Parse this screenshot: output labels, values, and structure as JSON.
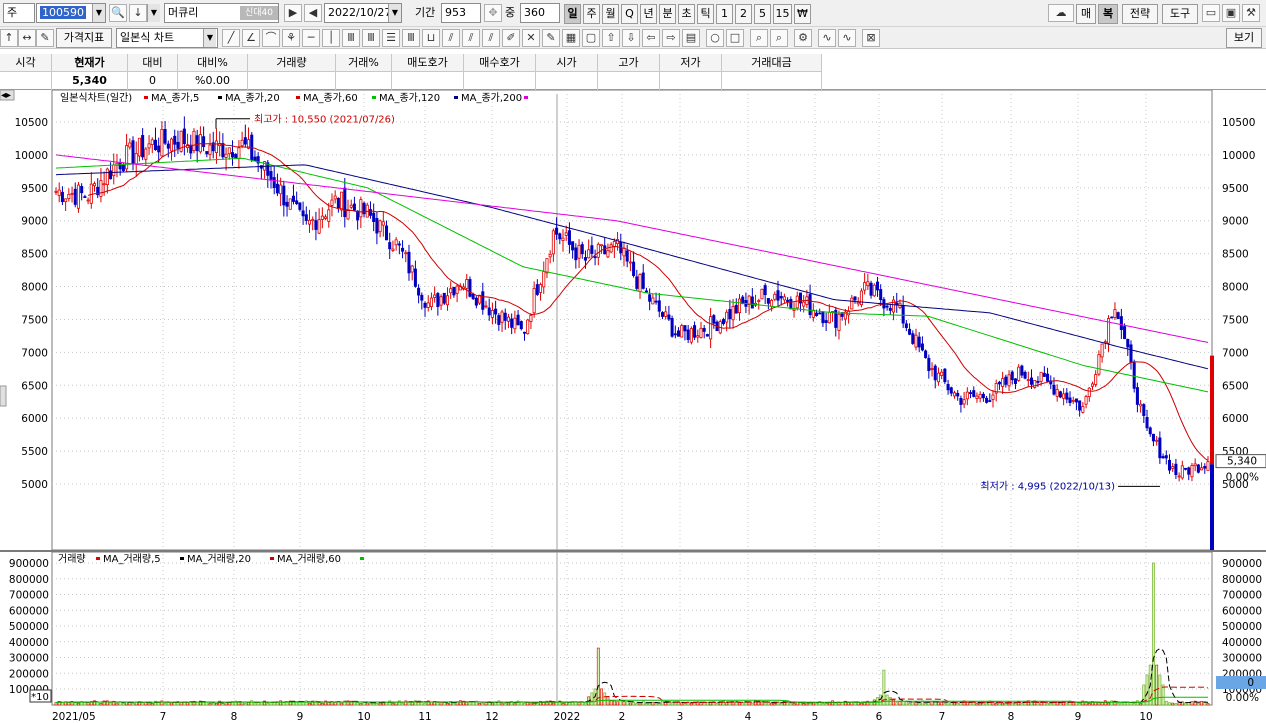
{
  "toolbar": {
    "market": "주",
    "code": "100590",
    "name": "머큐리",
    "name_tags": [
      "신",
      "대",
      "40"
    ],
    "date": "2022/10/27",
    "period_label": "기간",
    "period_value": "953",
    "count_label": "중",
    "count_value": "360",
    "timeframes": [
      "일",
      "주",
      "월",
      "Q",
      "년",
      "분",
      "초",
      "틱",
      "1",
      "2",
      "5",
      "15",
      "₩"
    ],
    "active_timeframe": "일",
    "right_buttons": [
      "매",
      "복",
      "전략",
      "도구"
    ]
  },
  "toolbar2": {
    "indicator_btn": "가격지표",
    "chart_type": "일본식 차트",
    "view_btn": "보기"
  },
  "quote": {
    "headers": [
      "시각",
      "현재가",
      "대비",
      "대비%",
      "거래량",
      "거래%",
      "매도호가",
      "매수호가",
      "시가",
      "고가",
      "저가",
      "거래대금"
    ],
    "values": [
      "",
      "5,340",
      "0",
      "%0.00",
      "",
      "",
      "",
      "",
      "",
      "",
      "",
      ""
    ]
  },
  "price_panel": {
    "legend_title": "일본식차트(일간)",
    "ma_legend": [
      {
        "label": "MA_종가,5",
        "color": "#e00000"
      },
      {
        "label": "MA_종가,20",
        "color": "#000000"
      },
      {
        "label": "MA_종가,60",
        "color": "#d00000"
      },
      {
        "label": "MA_종가,120",
        "color": "#00c000"
      },
      {
        "label": "MA_종가,200",
        "color": "#000080"
      },
      {
        "label": "",
        "color": "#e000e0"
      }
    ],
    "high_annotation": "최고가 : 10,550 (2021/07/26)",
    "low_annotation": "최저가 : 4,995 (2022/10/13)",
    "last_price": "5,340",
    "change_pct": "0.00%",
    "y_ticks": [
      "10500",
      "10000",
      "9500",
      "9000",
      "8500",
      "8000",
      "7500",
      "7000",
      "6500",
      "6000",
      "5500",
      "5000"
    ]
  },
  "volume_panel": {
    "legend_title": "거래량",
    "ma_legend": [
      {
        "label": "MA_거래량,5",
        "color": "#e00000"
      },
      {
        "label": "MA_거래량,20",
        "color": "#000000"
      },
      {
        "label": "MA_거래량,60",
        "color": "#d00000"
      },
      {
        "label": "",
        "color": "#00c000"
      }
    ],
    "scale_tag": "*10",
    "y_ticks": [
      "900000",
      "800000",
      "700000",
      "600000",
      "500000",
      "400000",
      "300000",
      "200000",
      "100000"
    ],
    "right_value": "0",
    "right_pct": "0.00%"
  },
  "x_labels": [
    "2021/05",
    "7",
    "8",
    "9",
    "10",
    "11",
    "12",
    "2022",
    "2",
    "3",
    "4",
    "5",
    "6",
    "7",
    "8",
    "9",
    "10"
  ],
  "colors": {
    "up": "#e00000",
    "down": "#0000c0",
    "ma5": "#e00000",
    "ma20": "#000000",
    "ma60": "#d00000",
    "ma120": "#00c000",
    "ma200": "#000080",
    "ma_extra": "#e000e0"
  },
  "chart_data": {
    "type": "candlestick",
    "symbol_code": "100590",
    "symbol_name": "머큐리",
    "price_ylim": [
      4600,
      10800
    ],
    "volume_ylim": [
      0,
      950000
    ],
    "highest": {
      "value": 10550,
      "date": "2021/07/26"
    },
    "lowest": {
      "value": 4995,
      "date": "2022/10/13"
    },
    "last_close": 5340,
    "close_path": [
      [
        "2021/05",
        9450
      ],
      [
        "2021/05b",
        9380
      ],
      [
        "2021/06",
        9900
      ],
      [
        "2021/06b",
        10150
      ],
      [
        "2021/07",
        10250
      ],
      [
        "2021/07b",
        10100
      ],
      [
        "2021/08",
        10150
      ],
      [
        "2021/08b",
        9600
      ],
      [
        "2021/08c",
        8900
      ],
      [
        "2021/09",
        9300
      ],
      [
        "2021/09b",
        9100
      ],
      [
        "2021/10",
        8600
      ],
      [
        "2021/10b",
        7700
      ],
      [
        "2021/11",
        8100
      ],
      [
        "2021/11b",
        7650
      ],
      [
        "2021/12",
        7300
      ],
      [
        "2021/12b",
        8850
      ],
      [
        "2022/01",
        8400
      ],
      [
        "2022/01b",
        8600
      ],
      [
        "2022/02",
        7850
      ],
      [
        "2022/02b",
        7250
      ],
      [
        "2022/03",
        7400
      ],
      [
        "2022/03b",
        7700
      ],
      [
        "2022/04",
        7900
      ],
      [
        "2022/04b",
        7750
      ],
      [
        "2022/05",
        7500
      ],
      [
        "2022/05b",
        7950
      ],
      [
        "2022/06",
        7700
      ],
      [
        "2022/06b",
        6800
      ],
      [
        "2022/07",
        6300
      ],
      [
        "2022/07b",
        6350
      ],
      [
        "2022/08",
        6700
      ],
      [
        "2022/08b",
        6500
      ],
      [
        "2022/09",
        6150
      ],
      [
        "2022/09b",
        7800
      ],
      [
        "2022/10",
        5800
      ],
      [
        "2022/10b",
        5150
      ],
      [
        "2022/10c",
        5340
      ]
    ],
    "ma_series": {
      "MA_종가,200": [
        [
          0,
          10000
        ],
        [
          18,
          9000
        ],
        [
          37,
          7150
        ]
      ],
      "MA_종가,120": [
        [
          0,
          9800
        ],
        [
          6,
          9950
        ],
        [
          10,
          9500
        ],
        [
          15,
          8300
        ],
        [
          19,
          7900
        ],
        [
          25,
          7600
        ],
        [
          28,
          7550
        ],
        [
          33,
          6800
        ],
        [
          37,
          6400
        ]
      ]
    },
    "volume_peaks": [
      {
        "x": "2021/12",
        "value": 360000
      },
      {
        "x": "2022/05",
        "value": 220000
      },
      {
        "x": "2022/09",
        "value": 900000
      }
    ]
  }
}
